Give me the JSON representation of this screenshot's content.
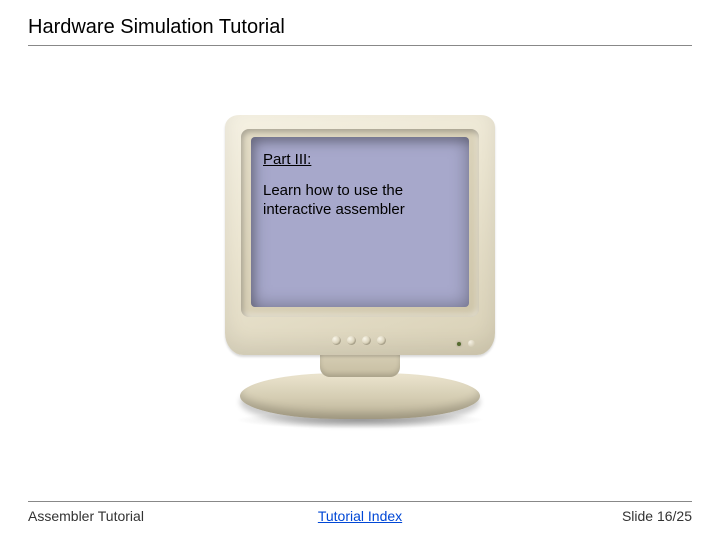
{
  "header": {
    "title": "Hardware Simulation Tutorial"
  },
  "screen": {
    "part_label": "Part III:",
    "description": "Learn how to use the interactive assembler"
  },
  "footer": {
    "left": "Assembler Tutorial",
    "link_text": "Tutorial Index",
    "slide_label": "Slide 16/25"
  }
}
